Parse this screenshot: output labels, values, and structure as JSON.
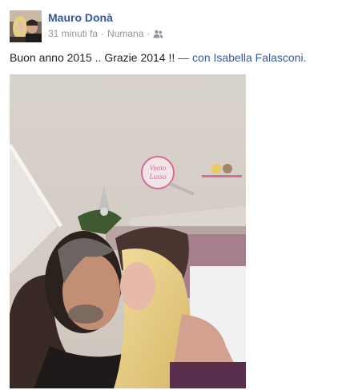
{
  "post": {
    "author": "Mauro Donà",
    "timestamp": "31 minuti fa",
    "location": "Numana",
    "separator": "·",
    "audience_icon": "friends-icon",
    "message": "Buon anno 2015 .. Grazie 2014 !!",
    "tag_prefix": "— con",
    "tagged_person": "Isabella Falasconi",
    "tag_suffix": ".",
    "photo_watermark": "Vuoto Lusso"
  },
  "colors": {
    "link": "#365899",
    "meta": "#90949c",
    "text": "#1d2129"
  }
}
